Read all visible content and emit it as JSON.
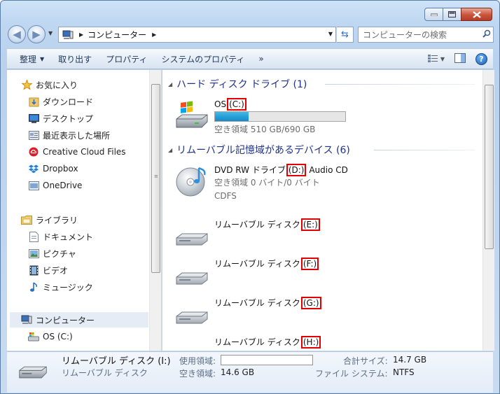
{
  "window": {
    "minimize_icon": "minimize-icon",
    "maximize_icon": "maximize-icon",
    "close_icon": "close-icon"
  },
  "address_bar": {
    "path": "コンピューター"
  },
  "search": {
    "placeholder": "コンピューターの検索"
  },
  "toolbar": {
    "organize": "整理",
    "eject": "取り出す",
    "properties": "プロパティ",
    "system_properties": "システムのプロパティ",
    "more": "»"
  },
  "nav": {
    "favorites": "お気に入り",
    "downloads": "ダウンロード",
    "desktop": "デスクトップ",
    "recent": "最近表示した場所",
    "creative_cloud": "Creative Cloud Files",
    "dropbox": "Dropbox",
    "onedrive": "OneDrive",
    "libraries": "ライブラリ",
    "documents": "ドキュメント",
    "pictures": "ピクチャ",
    "videos": "ビデオ",
    "music": "ミュージック",
    "computer": "コンピューター",
    "os_c": "OS (C:)"
  },
  "groups": {
    "hdd": "ハード ディスク ドライブ (1)",
    "removable": "リムーバブル記憶域があるデバイス (6)"
  },
  "drives": {
    "c": {
      "name": "OS",
      "letter": "(C:)",
      "free": "空き領域 510 GB/690 GB",
      "used_fraction": 0.26
    },
    "d": {
      "name": "DVD RW ドライブ",
      "letter": "(D:)",
      "media": "Audio CD",
      "free": "空き領域 0 バイト/0 バイト",
      "fs": "CDFS"
    },
    "e": {
      "name": "リムーバブル ディスク",
      "letter": "(E:)"
    },
    "f": {
      "name": "リムーバブル ディスク",
      "letter": "(F:)"
    },
    "g": {
      "name": "リムーバブル ディスク",
      "letter": "(G:)"
    },
    "h": {
      "name": "リムーバブル ディスク",
      "letter": "(H:)"
    }
  },
  "details": {
    "title": "リムーバブル ディスク (I:)",
    "type": "リムーバブル ディスク",
    "used_label": "使用領域:",
    "free_label": "空き領域:",
    "free_value": "14.6 GB",
    "total_label": "合計サイズ:",
    "total_value": "14.7 GB",
    "fs_label": "ファイル システム:",
    "fs_value": "NTFS"
  },
  "colors": {
    "accent": "#1e3287",
    "highlight_box": "#e00000",
    "bar_fill": "#26a0da"
  }
}
